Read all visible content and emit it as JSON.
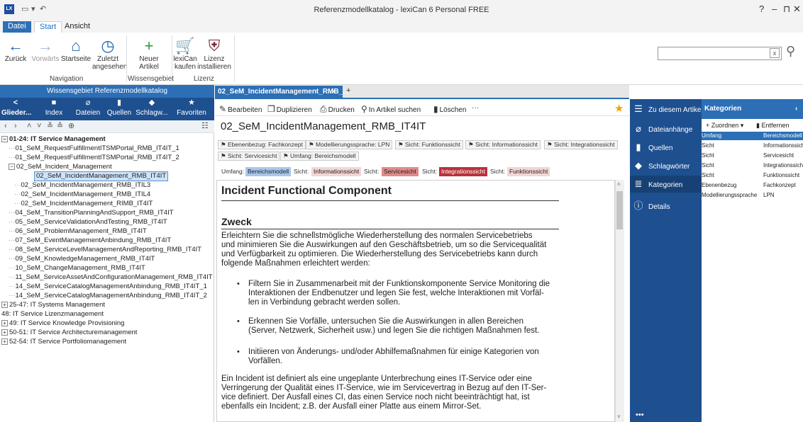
{
  "window": {
    "title": "Referenzmodellkatalog - lexiCan 6 Personal FREE",
    "logo": "LX",
    "controls": [
      "?",
      "–",
      "⊓",
      "✕"
    ]
  },
  "ribbon_tabs": [
    "Datei",
    "Start",
    "Ansicht"
  ],
  "ribbon": {
    "buttons": [
      {
        "label": "Zurück",
        "icon": "back-arrow-icon",
        "glyph": "←"
      },
      {
        "label": "Vorwärts",
        "icon": "forward-arrow-icon",
        "glyph": "→"
      },
      {
        "label": "Startseite",
        "icon": "home-icon",
        "glyph": "⌂"
      },
      {
        "label": "Zuletzt angesehen",
        "icon": "clock-icon",
        "glyph": "◷"
      },
      {
        "label": "Neuer Artikel",
        "icon": "plus-icon",
        "glyph": "+"
      },
      {
        "label": "lexiCan kaufen",
        "icon": "cart-icon",
        "glyph": "🛒"
      },
      {
        "label": "Lizenz installieren",
        "icon": "shield-icon",
        "glyph": "⛨"
      }
    ],
    "groups": [
      "Navigation",
      "Wissensgebiet",
      "Lizenz"
    ]
  },
  "left_panel": {
    "header": "Wissensgebiet Referenzmodellkatalog",
    "nav": [
      "Glieder...",
      "Index",
      "Dateien",
      "Quellen",
      "Schlagw...",
      "Favoriten"
    ],
    "tree": [
      {
        "text": "01-24: IT Service Management",
        "indent": 0,
        "toggle": "−",
        "bold": true
      },
      {
        "text": "01_SeM_RequestFulfillmentITSMPortal_RMB_IT4IT_1",
        "indent": 1
      },
      {
        "text": "01_SeM_RequestFulfillmentITSMPortal_RMB_IT4IT_2",
        "indent": 1
      },
      {
        "text": "02_SeM_Incident_Management",
        "indent": 1,
        "toggle": "−"
      },
      {
        "text": "02_SeM_IncidentManagement_RMB_IT4IT",
        "indent": 2,
        "selected": true
      },
      {
        "text": "02_SeM_IncidentManagement_RMB_ITIL3",
        "indent": 2
      },
      {
        "text": "02_SeM_IncidentManagement_RMB_ITIL4",
        "indent": 2
      },
      {
        "text": "02_SeM_IncidentManagement_RIMB_IT4IT",
        "indent": 2
      },
      {
        "text": "04_SeM_TransitionPlanningAndSupport_RMB_IT4IT",
        "indent": 1
      },
      {
        "text": "05_SeM_ServiceValidationAndTesting_RMB_IT4IT",
        "indent": 1
      },
      {
        "text": "06_SeM_ProblemManagement_RMB_IT4IT",
        "indent": 1
      },
      {
        "text": "07_SeM_EventManagementAnbindung_RMB_IT4IT",
        "indent": 1
      },
      {
        "text": "08_SeM_ServiceLevelManagementAndReporting_RMB_IT4IT",
        "indent": 1
      },
      {
        "text": "09_SeM_KnowledgeManagement_RMB_IT4IT",
        "indent": 1
      },
      {
        "text": "10_SeM_ChangeManagement_RMB_IT4IT",
        "indent": 1
      },
      {
        "text": "11_SeM_ServiceAssetAndConfigurationManagement_RMB_IT4IT",
        "indent": 1
      },
      {
        "text": "14_SeM_ServiceCatalogManagementAnbindung_RMB_IT4IT_1",
        "indent": 1
      },
      {
        "text": "14_SeM_ServiceCatalogManagementAnbindung_RMB_IT4IT_2",
        "indent": 1
      },
      {
        "text": "25-47: IT Systems Management",
        "indent": 0,
        "toggle": "+"
      },
      {
        "text": "48: IT Service Lizenzmanagement",
        "indent": 0
      },
      {
        "text": "49: IT Service Knowledge Provisioning",
        "indent": 0,
        "toggle": "+"
      },
      {
        "text": "50-51: IT Service Architecturemanagement",
        "indent": 0,
        "toggle": "+"
      },
      {
        "text": "52-54: IT Service Portfoliomanagement",
        "indent": 0,
        "toggle": "+"
      }
    ]
  },
  "doc_tab": {
    "label": "02_SeM_IncidentManagement_RMB_...",
    "close": "×",
    "add": "+"
  },
  "toolbar": [
    "Bearbeiten",
    "Duplizieren",
    "Drucken",
    "In Artikel suchen",
    "Löschen",
    "···"
  ],
  "document": {
    "title": "02_SeM_IncidentManagement_RMB_IT4IT",
    "tags": [
      "Ebenenbezug: Fachkonzept",
      "Modellierungssprache: LPN",
      "Sicht: Funktionssicht",
      "Sicht: Informationssicht",
      "Sicht: Integrationssicht",
      "Sicht: Servicesicht",
      "Umfang: Bereichsmodell"
    ],
    "properties": [
      {
        "label": "Umfang:",
        "value": "Bereichsmodell",
        "color": "#a9c7ee"
      },
      {
        "label": "Sicht:",
        "value": "Informationssicht",
        "color": "#f3d5d5"
      },
      {
        "label": "Sicht:",
        "value": "Servicesicht",
        "color": "#e18a8a"
      },
      {
        "label": "Sicht:",
        "value": "Integrationssicht",
        "color": "#b8323a"
      },
      {
        "label": "Sicht:",
        "value": "Funktionssicht",
        "color": "#f3d5d5"
      }
    ],
    "heading": "Incident Functional Component",
    "subheading": "Zweck",
    "intro": [
      "Erleichtern Sie die schnellstmögliche Wiederherstellung des normalen Servicebetriebs",
      "und minimieren Sie die Auswirkungen auf den Geschäftsbetrieb, um so die Servicequalität",
      "und Verfügbarkeit zu optimieren. Die Wiederherstellung des Servicebetriebs kann durch",
      "folgende Maßnahmen erleichtert werden:"
    ],
    "bullets": [
      [
        "Filtern Sie in Zusammenarbeit mit der Funktionskomponente Service Monitoring die",
        "Interaktionen der Endbenutzer und legen Sie fest, welche Interaktionen mit Vorfäl-",
        "len in Verbindung gebracht werden sollen."
      ],
      [
        "Erkennen Sie Vorfälle, untersuchen Sie die Auswirkungen in allen Bereichen",
        "(Server, Netzwerk, Sicherheit usw.) und legen Sie die richtigen Maßnahmen fest."
      ],
      [
        "Initiieren von Änderungs- und/oder Abhilfemaßnahmen für einige Kategorien von",
        "Vorfällen."
      ]
    ],
    "outro": [
      "Ein Incident ist definiert als eine ungeplante Unterbrechung eines IT-Service oder eine",
      "Verringerung der Qualität eines IT-Service, wie im Servicevertrag in Bezug auf den IT-Ser-",
      "vice definiert. Der Ausfall eines CI, das einen Service noch nicht beeinträchtigt hat, ist",
      "ebenfalls ein Incident; z.B. der Ausfall einer Platte aus einem Mirror-Set."
    ]
  },
  "right_nav": [
    {
      "label": "Zu diesem Artikel",
      "icon": "menu-icon",
      "glyph": "☰"
    },
    {
      "label": "Dateianhänge",
      "icon": "paperclip-icon",
      "glyph": "⌀"
    },
    {
      "label": "Quellen",
      "icon": "book-icon",
      "glyph": "▮"
    },
    {
      "label": "Schlagwörter",
      "icon": "tag-icon",
      "glyph": "◆"
    },
    {
      "label": "Kategorien",
      "icon": "list-icon",
      "glyph": "≣"
    },
    {
      "label": "Details",
      "icon": "info-icon",
      "glyph": "ⓘ"
    }
  ],
  "categories": {
    "title": "Kategorien",
    "assign": "Zuordnen",
    "remove": "Entfernen",
    "rows": [
      [
        "Umfang",
        "Bereichsmodell"
      ],
      [
        "Sicht",
        "Informationssicht"
      ],
      [
        "Sicht",
        "Servicesicht"
      ],
      [
        "Sicht",
        "Integrationssicht"
      ],
      [
        "Sicht",
        "Funktionssicht"
      ],
      [
        "Ebenenbezug",
        "Fachkonzept"
      ],
      [
        "Modellierungssprache",
        "LPN"
      ]
    ]
  }
}
